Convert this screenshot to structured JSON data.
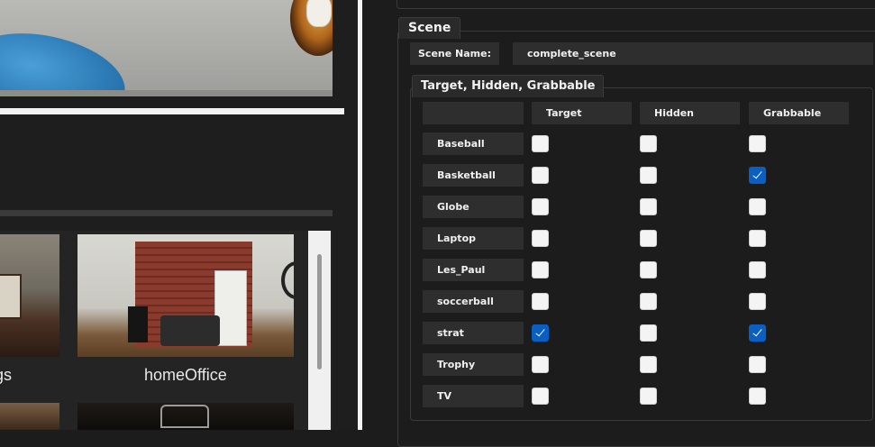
{
  "gallery": {
    "items": [
      {
        "label": "gs"
      },
      {
        "label": "homeOffice"
      }
    ]
  },
  "scene": {
    "title": "Scene",
    "name_label": "Scene Name:",
    "name_value": "complete_scene",
    "properties_title": "Target, Hidden, Grabbable",
    "columns": [
      "Target",
      "Hidden",
      "Grabbable"
    ],
    "objects": [
      {
        "name": "Baseball",
        "target": false,
        "hidden": false,
        "grabbable": false
      },
      {
        "name": "Basketball",
        "target": false,
        "hidden": false,
        "grabbable": true
      },
      {
        "name": "Globe",
        "target": false,
        "hidden": false,
        "grabbable": false
      },
      {
        "name": "Laptop",
        "target": false,
        "hidden": false,
        "grabbable": false
      },
      {
        "name": "Les_Paul",
        "target": false,
        "hidden": false,
        "grabbable": false
      },
      {
        "name": "soccerball",
        "target": false,
        "hidden": false,
        "grabbable": false
      },
      {
        "name": "strat",
        "target": true,
        "hidden": false,
        "grabbable": true
      },
      {
        "name": "Trophy",
        "target": false,
        "hidden": false,
        "grabbable": false
      },
      {
        "name": "TV",
        "target": false,
        "hidden": false,
        "grabbable": false
      }
    ]
  },
  "colors": {
    "background": "#1c1c1c",
    "cell": "#2e2e2e",
    "checked": "#0a5fc2"
  }
}
